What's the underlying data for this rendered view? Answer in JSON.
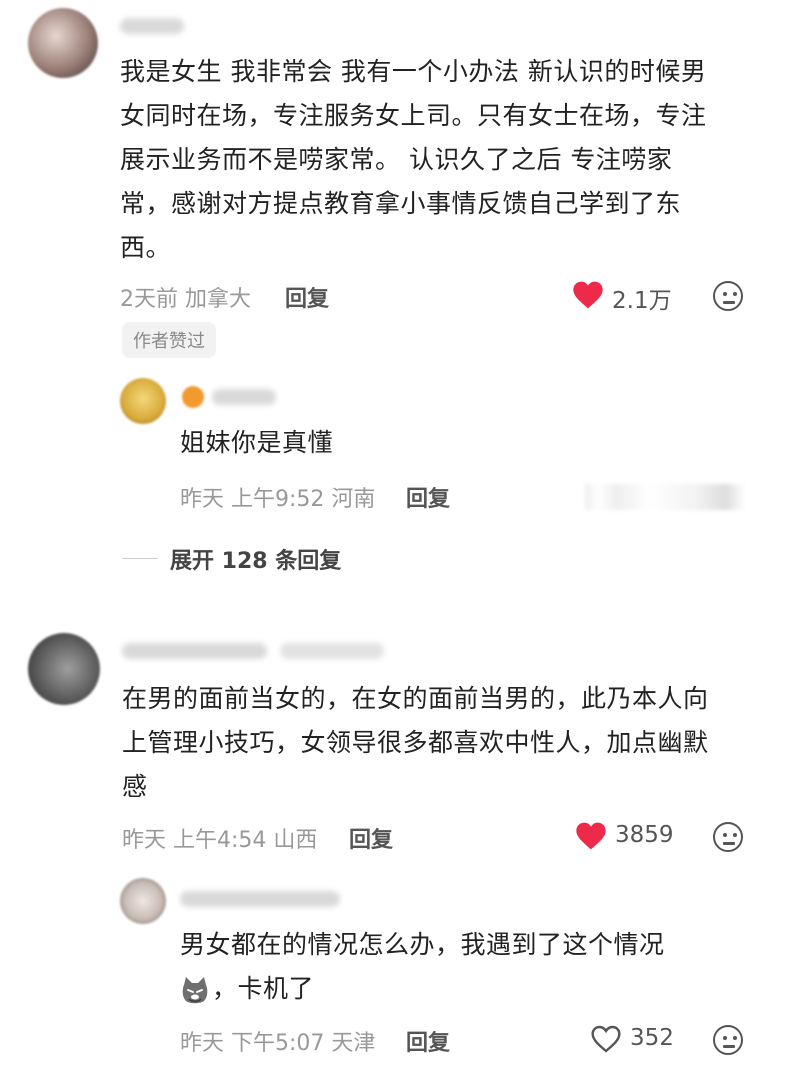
{
  "comments": [
    {
      "text": "我是女生 我非常会 我有一个小办法 新认识的时候男女同时在场，专注服务女上司。只有女士在场，专注展示业务而不是唠家常。 认识久了之后 专注唠家常，感谢对方提点教育拿小事情反馈自己学到了东西。",
      "lines": [
        "我是女生 我非常会 我有一个小办法 新认识的时候男",
        "女同时在场，专注服务女上司。只有女士在场，专注",
        "展示业务而不是唠家常。 认识久了之后 专注唠家",
        "常，感谢对方提点教育拿小事情反馈自己学到了东",
        "西。"
      ],
      "time": "2天前 加拿大",
      "reply_label": "回复",
      "likes": "2.1万",
      "badge": "作者赞过",
      "sub_reply": {
        "text": "姐妹你是真懂",
        "time": "昨天 上午9:52 河南",
        "reply_label": "回复"
      },
      "expand_label": "展开 128 条回复"
    },
    {
      "lines": [
        "在男的面前当女的，在女的面前当男的，此乃本人向",
        "上管理小技巧，女领导很多都喜欢中性人，加点幽默",
        "感"
      ],
      "time": "昨天 上午4:54 山西",
      "reply_label": "回复",
      "likes": "3859",
      "sub_reply": {
        "line1": "男女都在的情况怎么办，我遇到了这个情况",
        "line2": "，卡机了",
        "time": "昨天 下午5:07 天津",
        "reply_label": "回复",
        "likes": "352"
      }
    }
  ],
  "colors": {
    "like_active": "#ee2a4a",
    "muted": "#999999",
    "text": "#222222"
  },
  "icons": [
    "heart-filled-icon",
    "heart-outline-icon",
    "emoji-face-icon",
    "cat-emoji-icon"
  ]
}
